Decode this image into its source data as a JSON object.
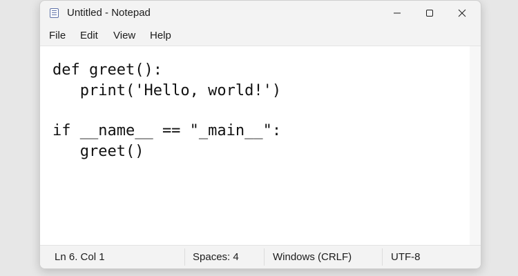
{
  "window": {
    "title": "Untitled - Notepad",
    "app_icon": "notepad-icon",
    "controls": {
      "minimize_icon": "minimize-icon",
      "maximize_icon": "maximize-icon",
      "close_icon": "close-icon"
    }
  },
  "menu": {
    "items": [
      {
        "label": "File"
      },
      {
        "label": "Edit"
      },
      {
        "label": "View"
      },
      {
        "label": "Help"
      }
    ]
  },
  "editor": {
    "lines": [
      "def greet():",
      "   print('Hello, world!')",
      "",
      "if __name__ == \"_main__\":",
      "   greet()"
    ]
  },
  "statusbar": {
    "position": "Ln 6. Col 1",
    "indentation": "Spaces: 4",
    "line_endings": "Windows (CRLF)",
    "encoding": "UTF-8"
  }
}
